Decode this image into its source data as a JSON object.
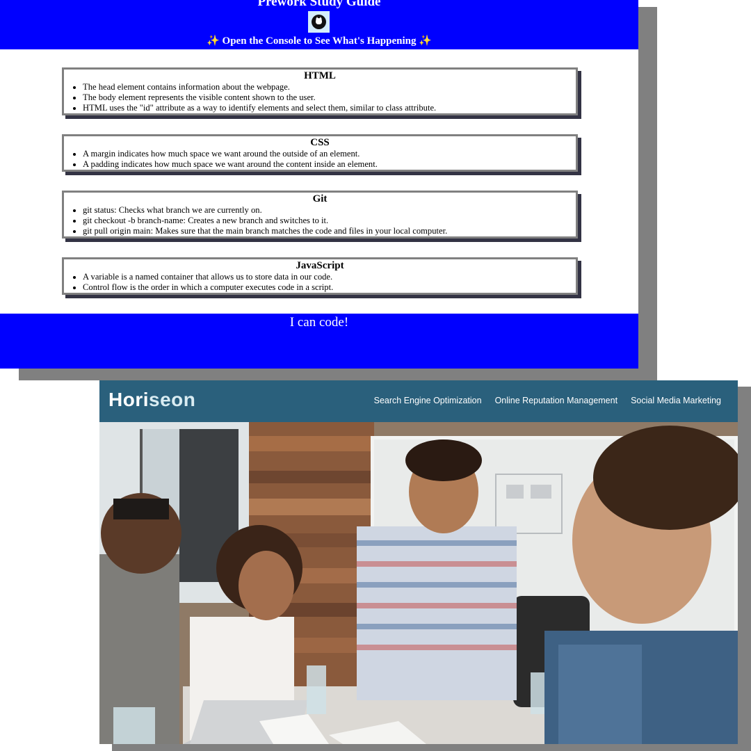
{
  "prework": {
    "title": "Prework Study Guide",
    "subtitle": "Open the Console to See What's Happening",
    "sparkle": "✨",
    "logo_icon": "cat-avatar-icon",
    "sections": [
      {
        "heading": "HTML",
        "items": [
          "The head element contains information about the webpage.",
          "The body element represents the visible content shown to the user.",
          "HTML uses the \"id\" attribute as a way to identify elements and select them, similar to class attribute."
        ]
      },
      {
        "heading": "CSS",
        "items": [
          "A margin indicates how much space we want around the outside of an element.",
          "A padding indicates how much space we want around the content inside an element."
        ]
      },
      {
        "heading": "Git",
        "items": [
          "git status: Checks what branch we are currently on.",
          "git checkout -b branch-name: Creates a new branch and switches to it.",
          "git pull origin main: Makes sure that the main branch matches the code and files in your local computer."
        ]
      },
      {
        "heading": "JavaScript",
        "items": [
          "A variable is a named container that allows us to store data in our code.",
          "Control flow is the order in which a computer executes code in a script."
        ]
      }
    ],
    "footer": "I can code!",
    "colors": {
      "header_bg": "#0000ff",
      "card_border": "#808080",
      "card_shadow": "#333344"
    }
  },
  "horiseon": {
    "logo_part1": "Hori",
    "logo_part2": "seon",
    "nav": [
      "Search Engine Optimization",
      "Online Reputation Management",
      "Social Media Marketing"
    ],
    "colors": {
      "header_bg": "#2a607c"
    }
  }
}
